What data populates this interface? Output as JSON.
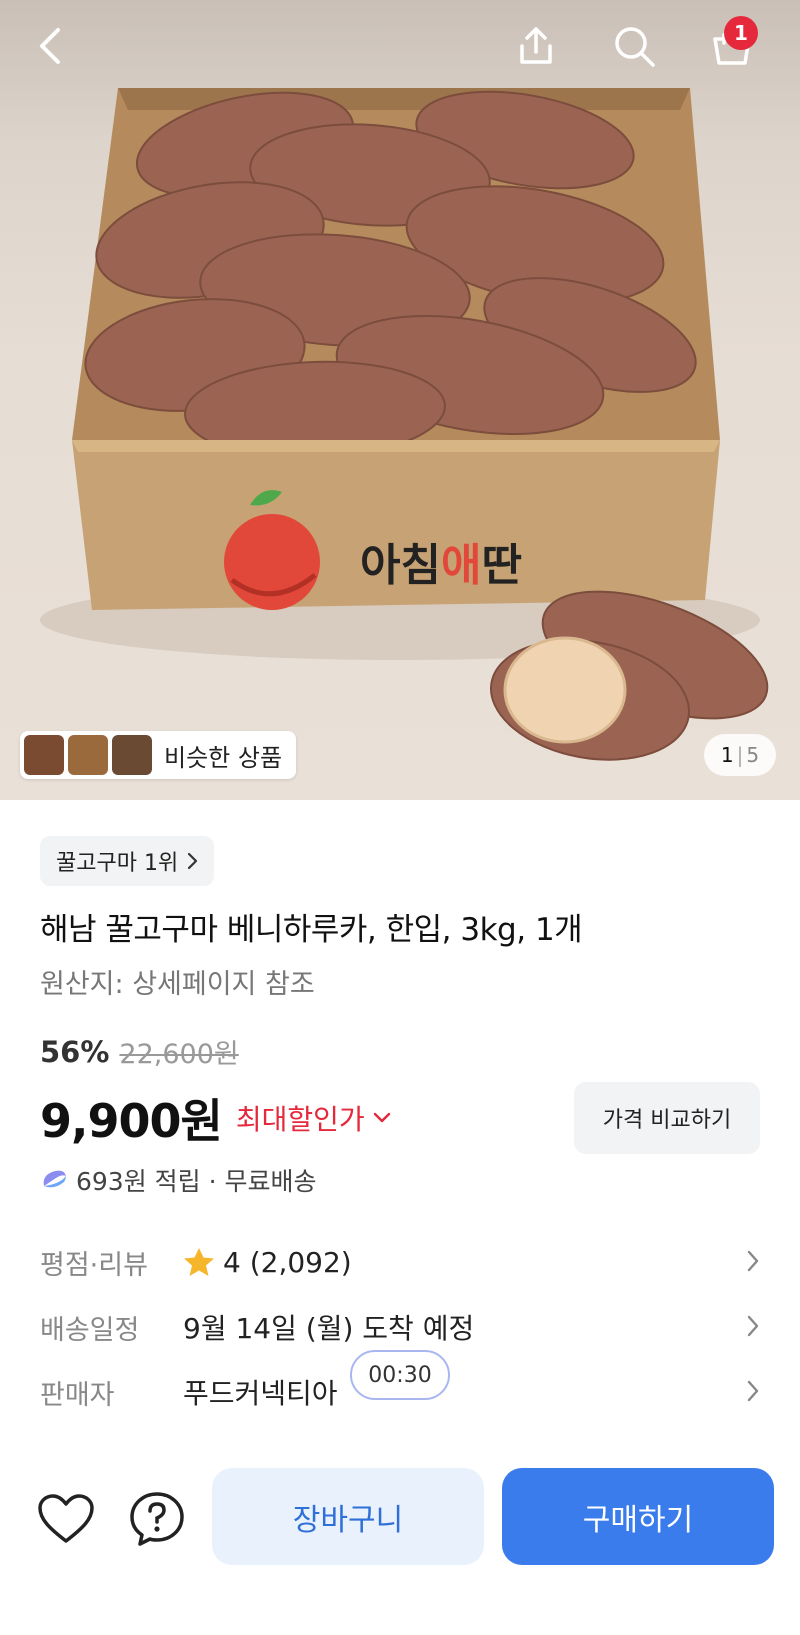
{
  "header": {
    "back_icon": "chevron-left-icon",
    "share_icon": "share-icon",
    "search_icon": "search-icon",
    "cart_icon": "cart-icon",
    "cart_count": "1"
  },
  "hero": {
    "brand_logo_text": "아침애딴",
    "similar_products_label": "비슷한 상품",
    "page_current": "1",
    "page_separator": "|",
    "page_total": "5"
  },
  "product": {
    "rank_label": "꿀고구마 1위",
    "title": "해남 꿀고구마 베니하루카, 한입, 3kg, 1개",
    "origin": "원산지: 상세페이지 참조",
    "discount_percent": "56%",
    "original_price": "22,600원",
    "price": "9,900원",
    "max_discount_label": "최대할인가",
    "compare_button": "가격 비교하기",
    "reward_text": "693원 적립 · 무료배송"
  },
  "info": {
    "rating_key": "평점·리뷰",
    "rating_value": "4 (2,092)",
    "delivery_key": "배송일정",
    "delivery_value": "9월 14일 (월) 도착 예정",
    "seller_key": "판매자",
    "seller_value": "푸드커넥티아",
    "timer": "00:30"
  },
  "bottom": {
    "cart_button": "장바구니",
    "buy_button": "구매하기"
  },
  "colors": {
    "accent_blue": "#3b7cec",
    "discount_red": "#e5283b",
    "badge_red": "#e5283b"
  }
}
